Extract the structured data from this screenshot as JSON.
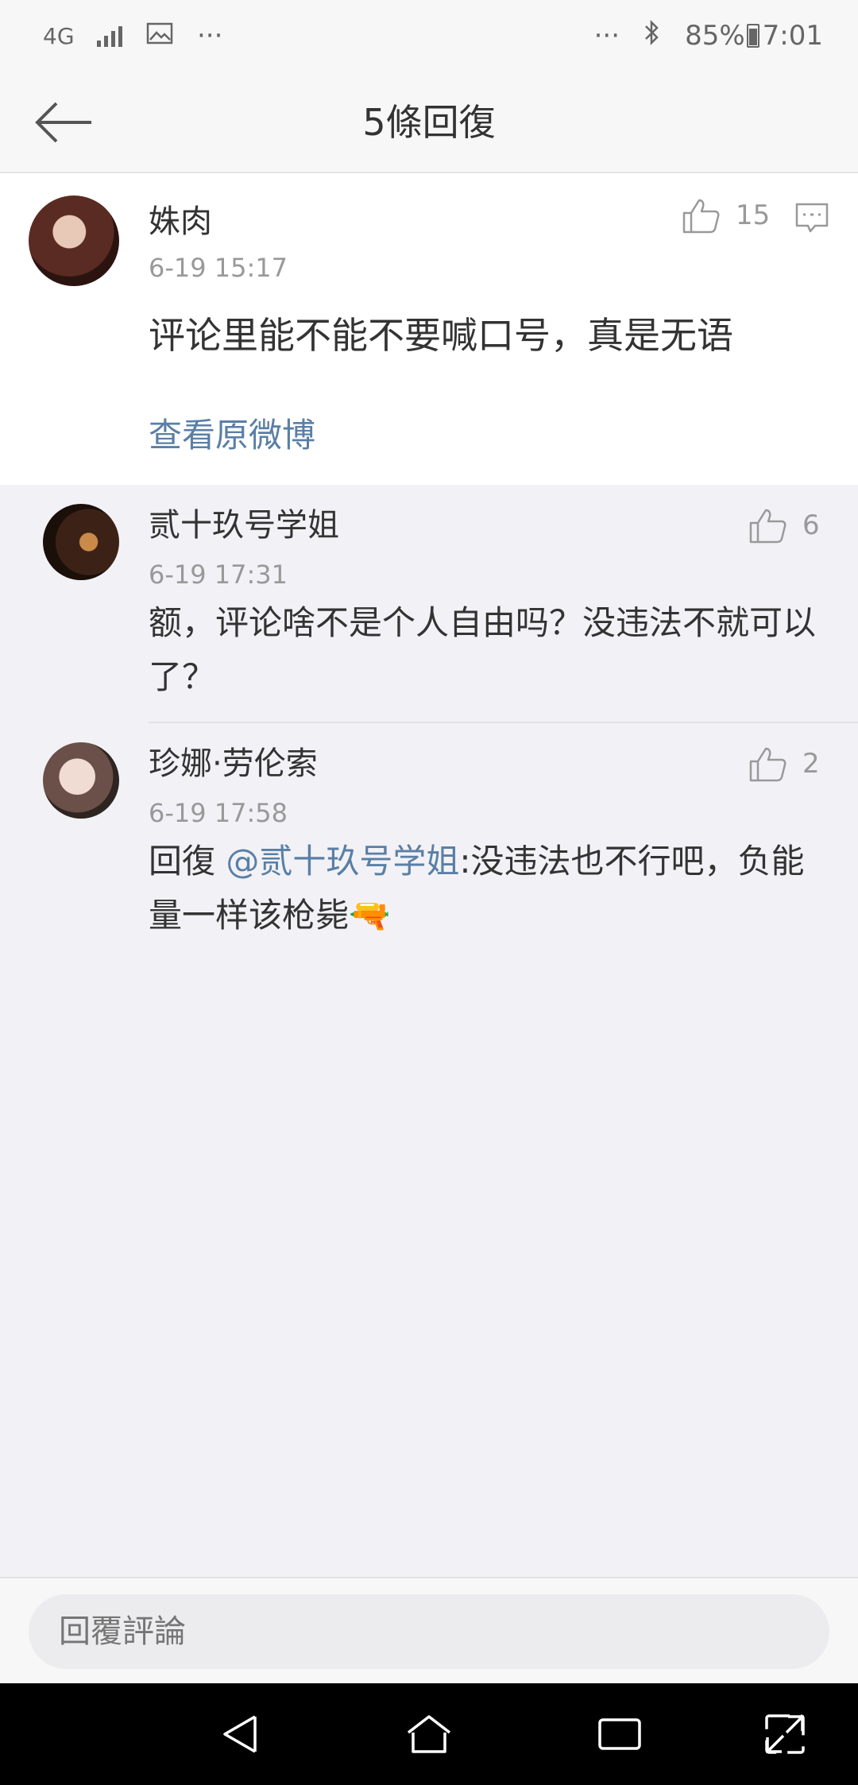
{
  "status_bar": {
    "network": "4G",
    "left_more": "···",
    "right_more": "···",
    "battery": "85%",
    "time": "7:01",
    "icons": [
      "signal-icon",
      "image-notification-icon",
      "bluetooth-icon",
      "battery-icon"
    ]
  },
  "nav": {
    "title": "5條回復",
    "back_icon": "arrow-left-icon"
  },
  "main_comment": {
    "username": "姝肉",
    "timestamp": "6-19 15:17",
    "likes": "15",
    "text": "评论里能不能不要喊口号，真是无语",
    "view_original": "查看原微博"
  },
  "replies": [
    {
      "username": "贰十玖号学姐",
      "timestamp": "6-19 17:31",
      "likes": "6",
      "text": "额，评论啥不是个人自由吗？没违法不就可以了？"
    },
    {
      "username": "珍娜·劳伦索",
      "timestamp": "6-19 17:58",
      "likes": "2",
      "reply_prefix": "回復 ",
      "mention": "@贰十玖号学姐",
      "text": ":没违法也不行吧，负能量一样该枪毙",
      "emoji": "🔫"
    }
  ],
  "bottom": {
    "placeholder": "回覆評論"
  },
  "colors": {
    "link": "#5a7fa6",
    "background": "#f2f2f6",
    "card": "#ffffff"
  }
}
